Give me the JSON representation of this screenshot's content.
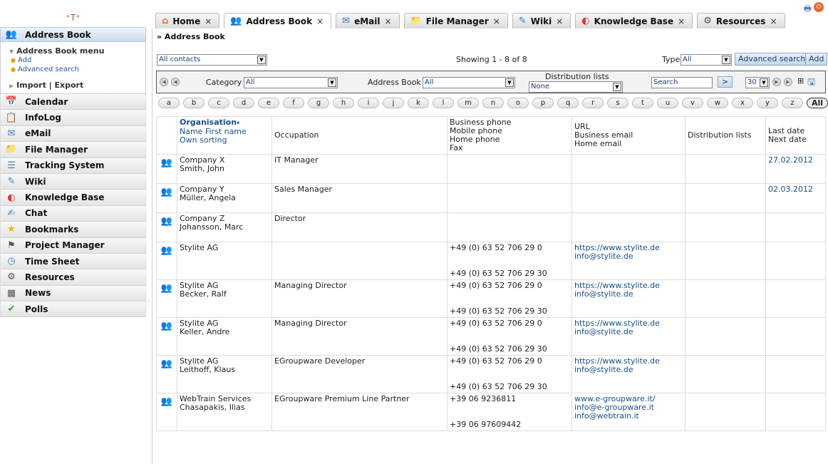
{
  "sidebar": {
    "logo": "⁺T⁺",
    "active_app": "Address Book",
    "menu_title": "Address Book menu",
    "menu_links": [
      "Add",
      "Advanced search"
    ],
    "import_export": "Import | Export",
    "apps": [
      {
        "label": "Calendar",
        "icon": "calendar-icon"
      },
      {
        "label": "InfoLog",
        "icon": "infolog-icon"
      },
      {
        "label": "eMail",
        "icon": "email-icon"
      },
      {
        "label": "File Manager",
        "icon": "file-manager-icon"
      },
      {
        "label": "Tracking System",
        "icon": "tracking-icon"
      },
      {
        "label": "Wiki",
        "icon": "wiki-icon"
      },
      {
        "label": "Knowledge Base",
        "icon": "knowledge-base-icon"
      },
      {
        "label": "Chat",
        "icon": "chat-icon"
      },
      {
        "label": "Bookmarks",
        "icon": "star-icon"
      },
      {
        "label": "Project Manager",
        "icon": "project-icon"
      },
      {
        "label": "Time Sheet",
        "icon": "clock-icon"
      },
      {
        "label": "Resources",
        "icon": "resources-icon"
      },
      {
        "label": "News",
        "icon": "news-icon"
      },
      {
        "label": "Polls",
        "icon": "polls-icon"
      }
    ]
  },
  "tabs": [
    {
      "label": "Home",
      "icon": "home-icon",
      "close": "×"
    },
    {
      "label": "Address Book",
      "icon": "address-book-icon",
      "close": "×"
    },
    {
      "label": "eMail",
      "icon": "email-icon",
      "close": "×"
    },
    {
      "label": "File Manager",
      "icon": "file-manager-icon",
      "close": "×"
    },
    {
      "label": "Wiki",
      "icon": "wiki-icon",
      "close": "×"
    },
    {
      "label": "Knowledge Base",
      "icon": "knowledge-base-icon",
      "close": "×"
    },
    {
      "label": "Resources",
      "icon": "resources-icon",
      "close": "×"
    }
  ],
  "breadcrumb": "» Address Book",
  "toolbar": {
    "contacts_select": "All contacts",
    "showing": "Showing 1 - 8 of 8",
    "type_label": "Type",
    "type_value": "All",
    "advanced_search": "Advanced search",
    "add": "Add"
  },
  "filters": {
    "category_label": "Category",
    "category_value": "All",
    "addressbook_label": "Address Book",
    "addressbook_value": "All",
    "distribution_label": "Distribution lists",
    "distribution_value": "None",
    "search_value": "Search",
    "go": ">",
    "per_page": "30"
  },
  "alphabet": [
    "a",
    "b",
    "c",
    "d",
    "e",
    "f",
    "g",
    "h",
    "i",
    "j",
    "k",
    "l",
    "m",
    "n",
    "o",
    "p",
    "q",
    "r",
    "s",
    "t",
    "u",
    "v",
    "w",
    "x",
    "y",
    "z",
    "All"
  ],
  "columns": {
    "org": "Organisation",
    "name": "Name First name",
    "own_sorting": "Own sorting",
    "occupation": "Occupation",
    "phones": [
      "Business phone",
      "Mobile phone",
      "Home phone",
      "Fax"
    ],
    "urls": [
      "URL",
      "Business email",
      "Home email"
    ],
    "distribution": "Distribution lists",
    "dates": [
      "Last date",
      "Next date"
    ]
  },
  "rows": [
    {
      "org": "Company X",
      "name": "Smith, John",
      "occupation": "IT Manager",
      "bphone": "",
      "fax": "",
      "url": "",
      "email": "",
      "email2": "",
      "date": "27.02.2012"
    },
    {
      "org": "Company Y",
      "name": "Müller, Angela",
      "occupation": "Sales Manager",
      "bphone": "",
      "fax": "",
      "url": "",
      "email": "",
      "email2": "",
      "date": "02.03.2012"
    },
    {
      "org": "Company Z",
      "name": "Johansson, Marc",
      "occupation": "Director",
      "bphone": "",
      "fax": "",
      "url": "",
      "email": "",
      "email2": "",
      "date": ""
    },
    {
      "org": "Stylite AG",
      "name": "",
      "occupation": "",
      "bphone": "+49 (0) 63 52 706 29 0",
      "fax": "+49 (0) 63 52 706 29 30",
      "url": "https://www.stylite.de",
      "email": "info@stylite.de",
      "email2": "",
      "date": ""
    },
    {
      "org": "Stylite AG",
      "name": "Becker, Ralf",
      "occupation": "Managing Director",
      "bphone": "+49 (0) 63 52 706 29 0",
      "fax": "+49 (0) 63 52 706 29 30",
      "url": "https://www.stylite.de",
      "email": "info@stylite.de",
      "email2": "",
      "date": ""
    },
    {
      "org": "Stylite AG",
      "name": "Keller, Andre",
      "occupation": "Managing Director",
      "bphone": "+49 (0) 63 52 706 29 0",
      "fax": "+49 (0) 63 52 706 29 30",
      "url": "https://www.stylite.de",
      "email": "info@stylite.de",
      "email2": "",
      "date": ""
    },
    {
      "org": "Stylite AG",
      "name": "Leithoff, Klaus",
      "occupation": "EGroupware Developer",
      "bphone": "+49 (0) 63 52 706 29 0",
      "fax": "+49 (0) 63 52 706 29 30",
      "url": "https://www.stylite.de",
      "email": "info@stylite.de",
      "email2": "",
      "date": ""
    },
    {
      "org": "WebTrain Services",
      "name": "Chasapakis, Ilias",
      "occupation": "EGroupware Premium Line Partner",
      "bphone": "+39 06 9236811",
      "fax": "+39 06 97609442",
      "url": "www.e-groupware.it/",
      "email": "info@e-groupware.it",
      "email2": "info@webtrain.it",
      "date": ""
    }
  ]
}
